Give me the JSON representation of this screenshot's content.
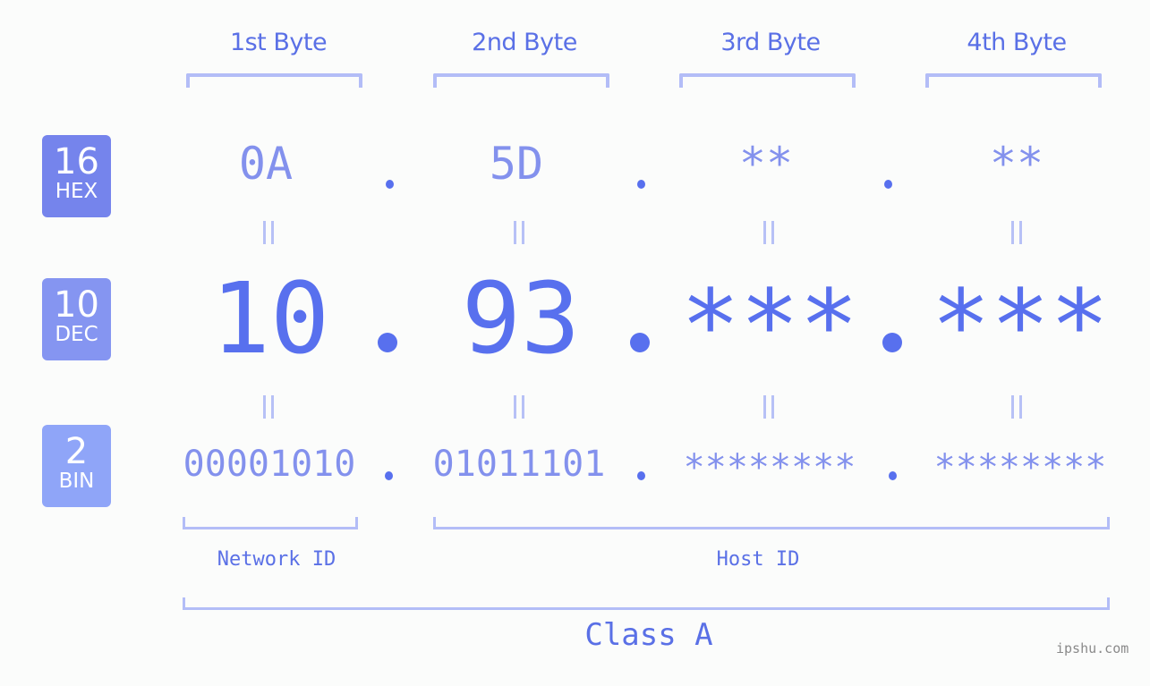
{
  "bytes": [
    {
      "header": "1st Byte",
      "hex": "0A",
      "dec": "10",
      "bin": "00001010"
    },
    {
      "header": "2nd Byte",
      "hex": "5D",
      "dec": "93",
      "bin": "01011101"
    },
    {
      "header": "3rd Byte",
      "hex": "**",
      "dec": "***",
      "bin": "********"
    },
    {
      "header": "4th Byte",
      "hex": "**",
      "dec": "***",
      "bin": "********"
    }
  ],
  "badges": {
    "hex": {
      "base": "16",
      "label": "HEX",
      "color": "#7584ec"
    },
    "dec": {
      "base": "10",
      "label": "DEC",
      "color": "#8595f1"
    },
    "bin": {
      "base": "2",
      "label": "BIN",
      "color": "#8fa5f8"
    }
  },
  "sections": {
    "network": "Network ID",
    "host": "Host ID"
  },
  "ip_class": "Class A",
  "watermark": "ipshu.com",
  "colors": {
    "accent": "#5870ee",
    "light_accent": "#8391ed",
    "bracket": "#b3bdf7",
    "background": "#fbfcfb"
  }
}
